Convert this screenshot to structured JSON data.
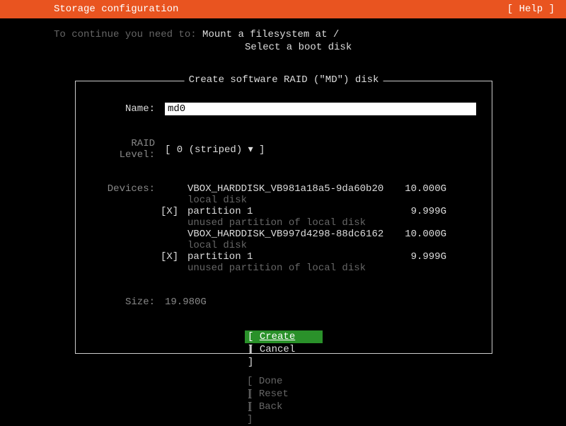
{
  "topbar": {
    "title": "Storage configuration",
    "help": "[ Help ]"
  },
  "hint": {
    "prefix": "To continue you need to: ",
    "line1": "Mount a filesystem at /",
    "line2": "Select a boot disk"
  },
  "panel": {
    "title": " Create software RAID (\"MD\") disk ",
    "name_label": "Name:",
    "name_value": "md0",
    "raid_label": "RAID Level:",
    "raid_value": "[ 0 (striped)   ▾ ]",
    "devices_label": "Devices:",
    "devices": [
      {
        "check": "",
        "name": "VBOX_HARDDISK_VB981a18a5-9da60b20",
        "size": "10.000G",
        "sub": "local disk",
        "is_sub_only": false
      },
      {
        "check": "[X]",
        "name": "partition 1",
        "size": "9.999G",
        "sub": "unused partition of local disk",
        "is_sub_only": false
      },
      {
        "check": "",
        "name": "VBOX_HARDDISK_VB997d4298-88dc6162",
        "size": "10.000G",
        "sub": "local disk",
        "is_sub_only": false
      },
      {
        "check": "[X]",
        "name": "partition 1",
        "size": "9.999G",
        "sub": "unused partition of local disk",
        "is_sub_only": false
      }
    ],
    "size_label": "Size:",
    "size_value": "19.980G",
    "create": "Create",
    "cancel": "Cancel"
  },
  "bottom": {
    "done": "Done",
    "reset": "Reset",
    "back": "Back"
  }
}
